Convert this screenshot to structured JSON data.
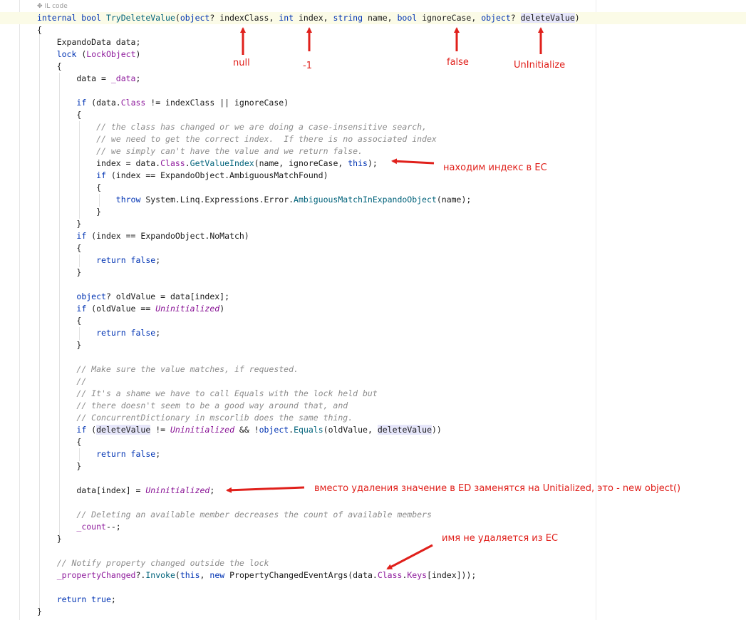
{
  "header": {
    "label": "IL code",
    "icon": "gear-icon"
  },
  "code_lines": [
    [
      [
        "kw",
        "internal bool "
      ],
      [
        "m",
        "TryDeleteValue"
      ],
      [
        "p",
        "("
      ],
      [
        "kw",
        "object"
      ],
      [
        "p",
        "? indexClass, "
      ],
      [
        "kw",
        "int"
      ],
      [
        "p",
        " index, "
      ],
      [
        "kw",
        "string"
      ],
      [
        "p",
        " name, "
      ],
      [
        "kw",
        "bool"
      ],
      [
        "p",
        " ignoreCase, "
      ],
      [
        "kw",
        "object"
      ],
      [
        "p",
        "? "
      ],
      [
        "hl",
        "deleteValue"
      ],
      [
        "p",
        ")"
      ]
    ],
    [
      [
        "p",
        "{"
      ]
    ],
    [
      [
        "p",
        "    ExpandoData data;"
      ]
    ],
    [
      [
        "p",
        "    "
      ],
      [
        "kw",
        "lock"
      ],
      [
        "p",
        " ("
      ],
      [
        "cls",
        "LockObject"
      ],
      [
        "p",
        ")"
      ]
    ],
    [
      [
        "p",
        "    {"
      ]
    ],
    [
      [
        "p",
        "        data = "
      ],
      [
        "cls",
        "_data"
      ],
      [
        "p",
        ";"
      ]
    ],
    [],
    [
      [
        "p",
        "        "
      ],
      [
        "kw",
        "if"
      ],
      [
        "p",
        " (data."
      ],
      [
        "cls",
        "Class"
      ],
      [
        "p",
        " != indexClass || ignoreCase)"
      ]
    ],
    [
      [
        "p",
        "        {"
      ]
    ],
    [
      [
        "p",
        "            "
      ],
      [
        "cm",
        "// the class has changed or we are doing a case-insensitive search,"
      ]
    ],
    [
      [
        "p",
        "            "
      ],
      [
        "cm",
        "// we need to get the correct index.  If there is no associated index"
      ]
    ],
    [
      [
        "p",
        "            "
      ],
      [
        "cm",
        "// we simply can't have the value and we return false."
      ]
    ],
    [
      [
        "p",
        "            index = data."
      ],
      [
        "cls",
        "Class"
      ],
      [
        "p",
        "."
      ],
      [
        "m",
        "GetValueIndex"
      ],
      [
        "p",
        "(name, ignoreCase, "
      ],
      [
        "kw",
        "this"
      ],
      [
        "p",
        ");"
      ]
    ],
    [
      [
        "p",
        "            "
      ],
      [
        "kw",
        "if"
      ],
      [
        "p",
        " (index == ExpandoObject.AmbiguousMatchFound)"
      ]
    ],
    [
      [
        "p",
        "            {"
      ]
    ],
    [
      [
        "p",
        "                "
      ],
      [
        "kw",
        "throw"
      ],
      [
        "p",
        " System.Linq.Expressions.Error."
      ],
      [
        "m",
        "AmbiguousMatchInExpandoObject"
      ],
      [
        "p",
        "(name);"
      ]
    ],
    [
      [
        "p",
        "            }"
      ]
    ],
    [
      [
        "p",
        "        }"
      ]
    ],
    [
      [
        "p",
        "        "
      ],
      [
        "kw",
        "if"
      ],
      [
        "p",
        " (index == ExpandoObject.NoMatch)"
      ]
    ],
    [
      [
        "p",
        "        {"
      ]
    ],
    [
      [
        "p",
        "            "
      ],
      [
        "kw",
        "return false"
      ],
      [
        "p",
        ";"
      ]
    ],
    [
      [
        "p",
        "        }"
      ]
    ],
    [],
    [
      [
        "p",
        "        "
      ],
      [
        "kw",
        "object"
      ],
      [
        "p",
        "? oldValue = data[index];"
      ]
    ],
    [
      [
        "p",
        "        "
      ],
      [
        "kw",
        "if"
      ],
      [
        "p",
        " (oldValue == "
      ],
      [
        "pi",
        "Uninitialized"
      ],
      [
        "p",
        ")"
      ]
    ],
    [
      [
        "p",
        "        {"
      ]
    ],
    [
      [
        "p",
        "            "
      ],
      [
        "kw",
        "return false"
      ],
      [
        "p",
        ";"
      ]
    ],
    [
      [
        "p",
        "        }"
      ]
    ],
    [],
    [
      [
        "p",
        "        "
      ],
      [
        "cm",
        "// Make sure the value matches, if requested."
      ]
    ],
    [
      [
        "p",
        "        "
      ],
      [
        "cm",
        "//"
      ]
    ],
    [
      [
        "p",
        "        "
      ],
      [
        "cm",
        "// It's a shame we have to call Equals with the lock held but"
      ]
    ],
    [
      [
        "p",
        "        "
      ],
      [
        "cm",
        "// there doesn't seem to be a good way around that, and"
      ]
    ],
    [
      [
        "p",
        "        "
      ],
      [
        "cm",
        "// ConcurrentDictionary in mscorlib does the same thing."
      ]
    ],
    [
      [
        "p",
        "        "
      ],
      [
        "kw",
        "if"
      ],
      [
        "p",
        " ("
      ],
      [
        "hl",
        "deleteValue"
      ],
      [
        "p",
        " != "
      ],
      [
        "pi",
        "Uninitialized"
      ],
      [
        "p",
        " && !"
      ],
      [
        "kw",
        "object"
      ],
      [
        "p",
        "."
      ],
      [
        "m",
        "Equals"
      ],
      [
        "p",
        "(oldValue, "
      ],
      [
        "hl",
        "deleteValue"
      ],
      [
        "p",
        "))"
      ]
    ],
    [
      [
        "p",
        "        {"
      ]
    ],
    [
      [
        "p",
        "            "
      ],
      [
        "kw",
        "return false"
      ],
      [
        "p",
        ";"
      ]
    ],
    [
      [
        "p",
        "        }"
      ]
    ],
    [],
    [
      [
        "p",
        "        data[index] = "
      ],
      [
        "pi",
        "Uninitialized"
      ],
      [
        "p",
        ";"
      ]
    ],
    [],
    [
      [
        "p",
        "        "
      ],
      [
        "cm",
        "// Deleting an available member decreases the count of available members"
      ]
    ],
    [
      [
        "p",
        "        "
      ],
      [
        "cls",
        "_count"
      ],
      [
        "p",
        "--;"
      ]
    ],
    [
      [
        "p",
        "    }"
      ]
    ],
    [],
    [
      [
        "p",
        "    "
      ],
      [
        "cm",
        "// Notify property changed outside the lock"
      ]
    ],
    [
      [
        "p",
        "    "
      ],
      [
        "cls",
        "_propertyChanged"
      ],
      [
        "p",
        "?."
      ],
      [
        "m",
        "Invoke"
      ],
      [
        "p",
        "("
      ],
      [
        "kw",
        "this"
      ],
      [
        "p",
        ", "
      ],
      [
        "kw",
        "new"
      ],
      [
        "p",
        " PropertyChangedEventArgs(data."
      ],
      [
        "cls",
        "Class"
      ],
      [
        "p",
        "."
      ],
      [
        "cls",
        "Keys"
      ],
      [
        "p",
        "[index]));"
      ]
    ],
    [],
    [
      [
        "p",
        "    "
      ],
      [
        "kw",
        "return true"
      ],
      [
        "p",
        ";"
      ]
    ],
    [
      [
        "p",
        "}"
      ]
    ]
  ],
  "annotations": {
    "null": "null",
    "minus_one": "-1",
    "false": "false",
    "uninitialize": "UnInitialize",
    "find_index": "находим индекс в EC",
    "replace": "вместо удаления значение в ED заменятся на Unitialized, это - new object()",
    "not_removed": "имя не удаляется из EC"
  },
  "colors": {
    "keyword": "#0033b3",
    "method": "#00627a",
    "field": "#8e1a9c",
    "comment": "#8c8c8c",
    "annotation": "#e0201b",
    "line_highlight": "#fbfbe7",
    "symbol_highlight": "#e6e6fa"
  }
}
